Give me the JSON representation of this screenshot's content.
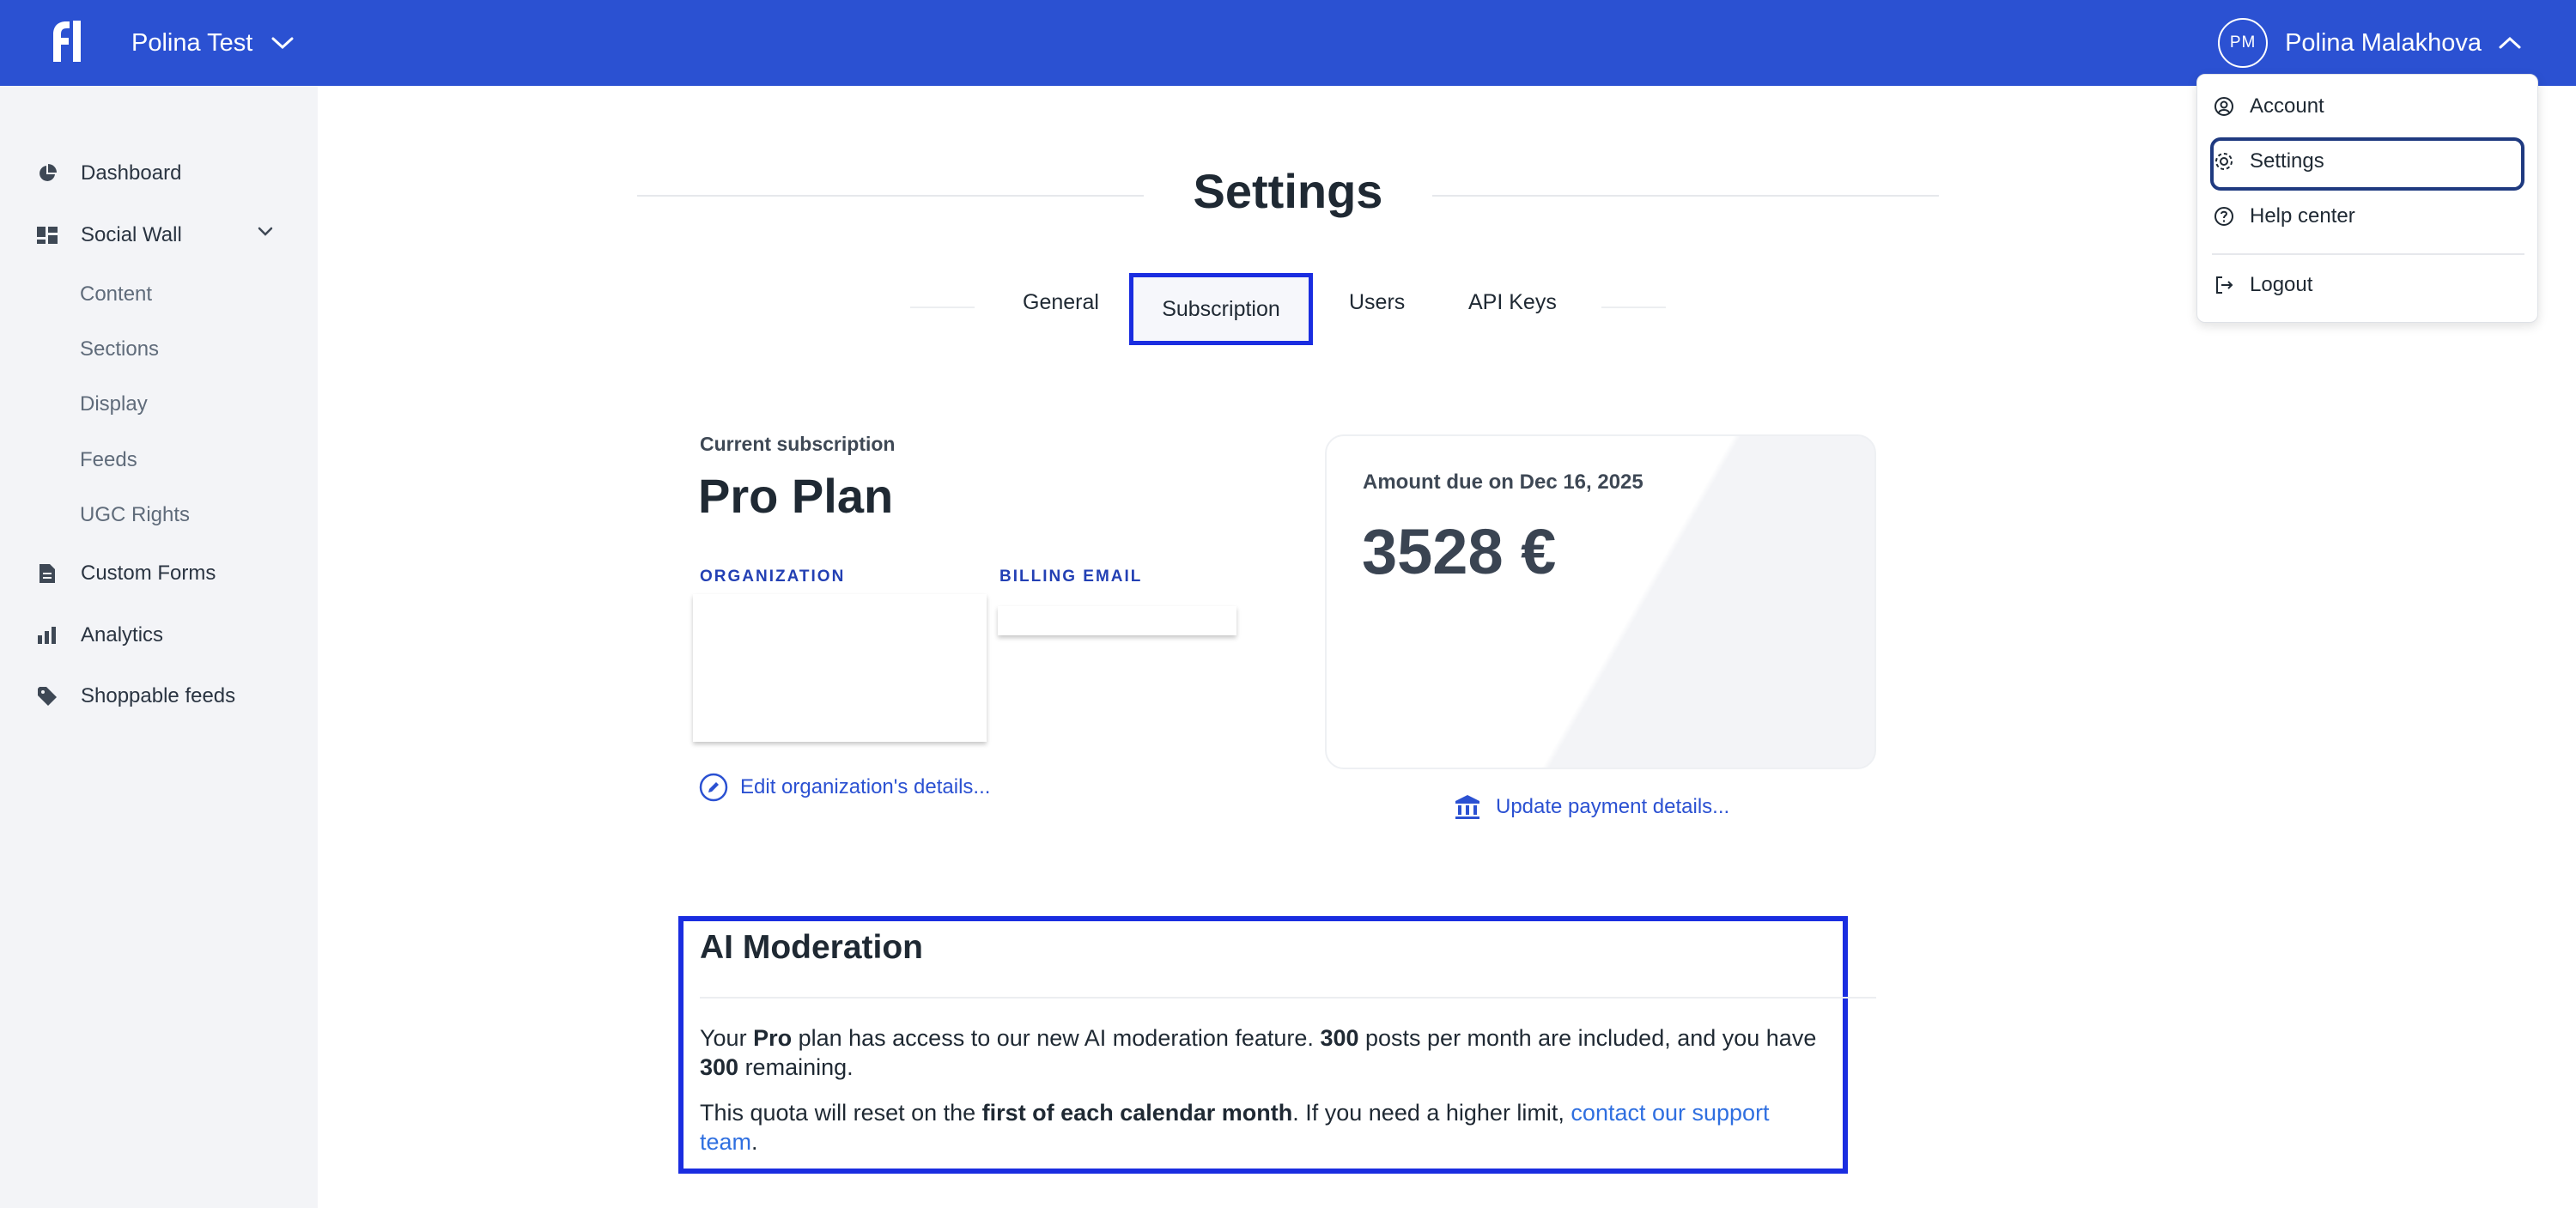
{
  "topbar": {
    "workspace": "Polina Test",
    "user_initials": "PM",
    "user_name": "Polina Malakhova"
  },
  "sidebar": {
    "items": [
      {
        "label": "Dashboard",
        "icon": "pie-chart-icon"
      },
      {
        "label": "Social Wall",
        "icon": "wall-icon"
      },
      {
        "label": "Custom Forms",
        "icon": "form-icon"
      },
      {
        "label": "Analytics",
        "icon": "bar-chart-icon"
      },
      {
        "label": "Shoppable feeds",
        "icon": "tag-icon"
      }
    ],
    "social_wall_sub": [
      "Content",
      "Sections",
      "Display",
      "Feeds",
      "UGC Rights"
    ]
  },
  "page": {
    "title": "Settings",
    "tabs": [
      "General",
      "Subscription",
      "Users",
      "API Keys"
    ],
    "active_tab": "Subscription"
  },
  "subscription": {
    "current_label": "Current subscription",
    "plan": "Pro Plan",
    "org_label": "ORGANIZATION",
    "billing_label": "BILLING EMAIL",
    "edit_link": "Edit organization's details...",
    "due_label": "Amount due on Dec 16, 2025",
    "due_amount": "3528 €",
    "payment_link": "Update payment details..."
  },
  "ai": {
    "title": "AI Moderation",
    "p1_a": "Your ",
    "p1_plan": "Pro",
    "p1_b": " plan has access to our new AI moderation feature. ",
    "p1_included": "300",
    "p1_c": " posts per month are included, and you have ",
    "p1_remaining": "300",
    "p1_d": " remaining.",
    "p2_a": "This quota will reset on the ",
    "p2_bold": "first of each calendar month",
    "p2_b": ". If you need a higher limit, ",
    "p2_link": "contact our support team",
    "p2_c": "."
  },
  "user_menu": {
    "items": [
      "Account",
      "Settings",
      "Help center",
      "Logout"
    ],
    "active": "Settings"
  },
  "colors": {
    "brand": "#2b51d2",
    "highlight": "#1a2de0",
    "link": "#2f6fe0"
  }
}
